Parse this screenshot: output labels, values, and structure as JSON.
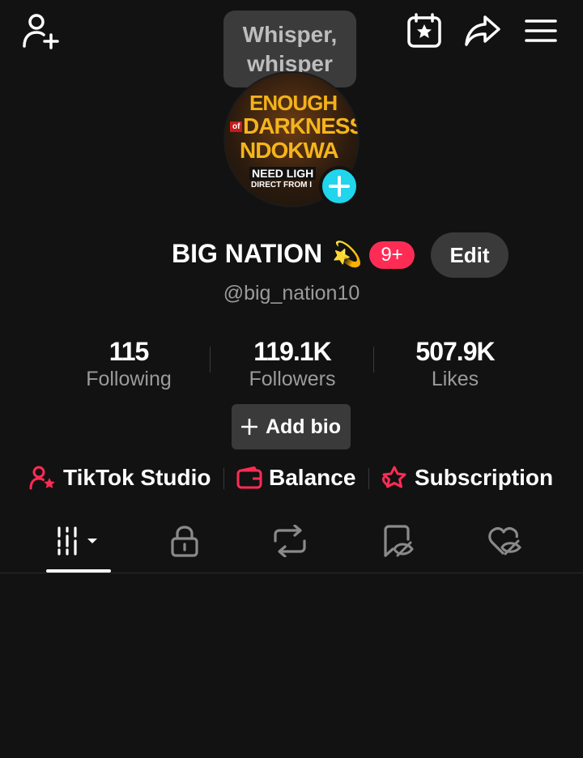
{
  "header": {
    "add_friend_icon": "person-plus-icon",
    "calendar_icon": "calendar-star-icon",
    "share_icon": "share-arrow-icon",
    "menu_icon": "hamburger-menu-icon"
  },
  "tooltip": {
    "line1": "Whisper,",
    "line2": "whisper"
  },
  "avatar": {
    "poster_line1": "ENOUGH",
    "poster_of": "of",
    "poster_line2": "DARKNESS",
    "poster_line3": "NDOKWA",
    "poster_line4": "NEED LIGH",
    "poster_line5": "DIRECT FROM I"
  },
  "profile": {
    "name": "BIG NATION",
    "name_emoji": "💫",
    "notification_badge": "9+",
    "edit_label": "Edit",
    "handle": "@big_nation10"
  },
  "stats": [
    {
      "value": "115",
      "label": "Following"
    },
    {
      "value": "119.1K",
      "label": "Followers"
    },
    {
      "value": "507.9K",
      "label": "Likes"
    }
  ],
  "add_bio": {
    "label": "Add bio"
  },
  "links": [
    {
      "label": "TikTok Studio",
      "icon": "person-star-icon"
    },
    {
      "label": "Balance",
      "icon": "wallet-icon"
    },
    {
      "label": "Subscription",
      "icon": "star-heart-icon"
    }
  ],
  "tabs": [
    {
      "name": "videos-grid",
      "icon": "grid-bars-icon",
      "active": true
    },
    {
      "name": "private",
      "icon": "lock-icon"
    },
    {
      "name": "reposts",
      "icon": "repost-icon"
    },
    {
      "name": "favorites",
      "icon": "bookmark-eye-icon"
    },
    {
      "name": "liked",
      "icon": "heart-eye-icon"
    }
  ],
  "colors": {
    "background": "#121212",
    "accent_red": "#fe2c55",
    "accent_cyan": "#20d5ec",
    "muted_text": "#9b9b9b"
  }
}
